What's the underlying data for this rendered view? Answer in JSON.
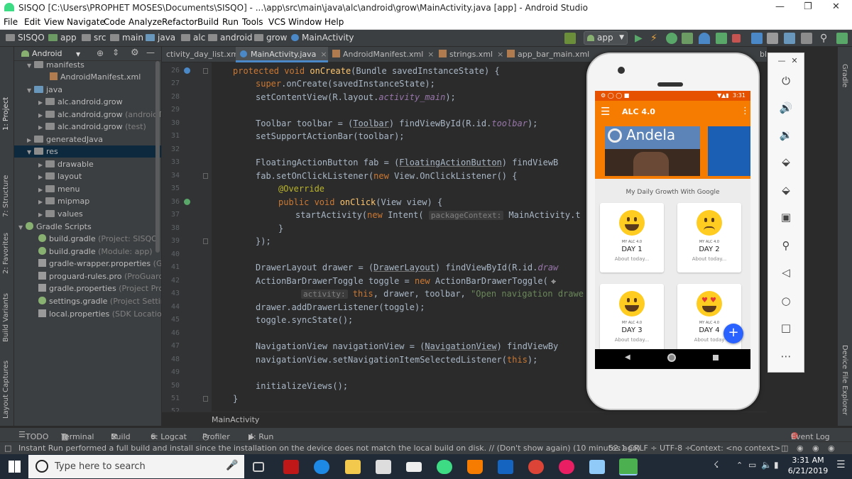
{
  "window": {
    "title": "SISQO [C:\\Users\\PROPHET MOSES\\Documents\\SISQO] - ...\\app\\src\\main\\java\\alc\\android\\grow\\MainActivity.java [app] - Android Studio"
  },
  "menu": [
    "File",
    "Edit",
    "View",
    "Navigate",
    "Code",
    "Analyze",
    "Refactor",
    "Build",
    "Run",
    "Tools",
    "VCS",
    "Window",
    "Help"
  ],
  "breadcrumbs": [
    "SISQO",
    "app",
    "src",
    "main",
    "java",
    "alc",
    "android",
    "grow",
    "MainActivity"
  ],
  "run_config": "app",
  "project_panel": {
    "view": "Android",
    "tree": [
      {
        "label": "manifests",
        "sub": ""
      },
      {
        "label": "AndroidManifest.xml",
        "sub": ""
      },
      {
        "label": "java",
        "sub": ""
      },
      {
        "label": "alc.android.grow",
        "sub": ""
      },
      {
        "label": "alc.android.grow",
        "sub": "(androidTest)"
      },
      {
        "label": "alc.android.grow",
        "sub": "(test)"
      },
      {
        "label": "generatedJava",
        "sub": ""
      },
      {
        "label": "res",
        "sub": ""
      },
      {
        "label": "drawable",
        "sub": ""
      },
      {
        "label": "layout",
        "sub": ""
      },
      {
        "label": "menu",
        "sub": ""
      },
      {
        "label": "mipmap",
        "sub": ""
      },
      {
        "label": "values",
        "sub": ""
      },
      {
        "label": "Gradle Scripts",
        "sub": ""
      },
      {
        "label": "build.gradle",
        "sub": "(Project: SISQO)"
      },
      {
        "label": "build.gradle",
        "sub": "(Module: app)"
      },
      {
        "label": "gradle-wrapper.properties",
        "sub": "(Gradle"
      },
      {
        "label": "proguard-rules.pro",
        "sub": "(ProGuard Ru"
      },
      {
        "label": "gradle.properties",
        "sub": "(Project Properti"
      },
      {
        "label": "settings.gradle",
        "sub": "(Project Settings)"
      },
      {
        "label": "local.properties",
        "sub": "(SDK Location)"
      }
    ]
  },
  "left_tools": [
    "1: Project",
    "7: Structure",
    "2: Favorites",
    "Build Variants",
    "Layout Captures"
  ],
  "right_tools": [
    "Gradle",
    "Device File Explorer"
  ],
  "tabs": [
    "ctivity_day_list.xml",
    "MainActivity.java",
    "AndroidManifest.xml",
    "strings.xml",
    "app_bar_main.xml",
    "bl"
  ],
  "line_numbers": [
    "26",
    "27",
    "28",
    "29",
    "30",
    "31",
    "32",
    "33",
    "34",
    "35",
    "36",
    "37",
    "38",
    "39",
    "40",
    "41",
    "42",
    "43",
    "44",
    "45",
    "46",
    "47",
    "48",
    "49",
    "50",
    "51",
    "52"
  ],
  "code": {
    "l26a": "protected void ",
    "l26b": "onCreate",
    "l26c": "(Bundle savedInstanceState) {",
    "l27a": "super",
    "l27b": ".onCreate(savedInstanceState);",
    "l28a": "setContentView(R.layout.",
    "l28b": "activity_main",
    "l28c": ");",
    "l30a": "Toolbar toolbar = (",
    "l30b": "Toolbar",
    "l30c": ") findViewById(R.id.",
    "l30d": "toolbar",
    "l30e": ");",
    "l31": "setSupportActionBar(toolbar);",
    "l33a": "FloatingActionButton fab = (",
    "l33b": "FloatingActionButton",
    "l33c": ") findViewB",
    "l34a": "fab.setOnClickListener(",
    "l34b": "new ",
    "l34c": "View.OnClickListener() {",
    "l35": "@Override",
    "l36a": "public void ",
    "l36b": "onClick",
    "l36c": "(View view) {",
    "l37a": "startActivity(",
    "l37b": "new ",
    "l37c": "Intent( ",
    "l37hint": "packageContext:",
    "l37d": " MainActivity.t",
    "l38": "}",
    "l39": "});",
    "l41a": "DrawerLayout drawer = (",
    "l41b": "DrawerLayout",
    "l41c": ") findViewById(R.id.",
    "l41d": "draw",
    "l42a": "ActionBarDrawerToggle toggle = ",
    "l42b": "new ",
    "l42c": "ActionBarDrawerToggle(",
    "l43hint": "activity:",
    "l43a": " this",
    "l43b": ", drawer, toolbar, ",
    "l43c": "\"Open navigation drawe",
    "l44": "drawer.addDrawerListener(toggle);",
    "l45": "toggle.syncState();",
    "l47a": "NavigationView navigationView = (",
    "l47b": "NavigationView",
    "l47c": ") findViewBy",
    "l48a": "navigationView.setNavigationItemSelectedListener(",
    "l48b": "this",
    "l48c": ");",
    "l50": "initializeViews();",
    "l51": "}"
  },
  "editor_breadcrumb": "MainActivity",
  "tool_windows": [
    "TODO",
    "Terminal",
    "Build",
    "6: Logcat",
    "Profiler",
    "4: Run"
  ],
  "event_log": "Event Log",
  "status": {
    "message": "Instant Run performed a full build and install since the installation on the device does not match the local build on disk. // (Don't show again) (10 minutes ago)",
    "position": "52:1",
    "line_sep": "CRLF ÷",
    "encoding": "UTF-8 ÷",
    "context": "Context: <no context>"
  },
  "phone": {
    "time": "3:31",
    "app_title": "ALC 4.0",
    "banner_text": "Andela",
    "subtitle": "My Daily Growth With Google",
    "cards": [
      {
        "small": "MY ALC 4.0",
        "day": "DAY 1",
        "desc": "About today...",
        "mood": "happy"
      },
      {
        "small": "MY ALC 4.0",
        "day": "DAY 2",
        "desc": "About today...",
        "mood": "sad"
      },
      {
        "small": "MY ALC 4.0",
        "day": "DAY 3",
        "desc": "About today...",
        "mood": "happy"
      },
      {
        "small": "MY ALC 4.0",
        "day": "DAY 4",
        "desc": "About today",
        "mood": "love"
      }
    ],
    "fab": "+"
  },
  "taskbar": {
    "search_placeholder": "Type here to search",
    "time": "3:31 AM",
    "date": "6/21/2019"
  },
  "colors": {
    "accent": "#f57c00",
    "fab": "#2962ff",
    "tab_active": "#4a88c7"
  }
}
